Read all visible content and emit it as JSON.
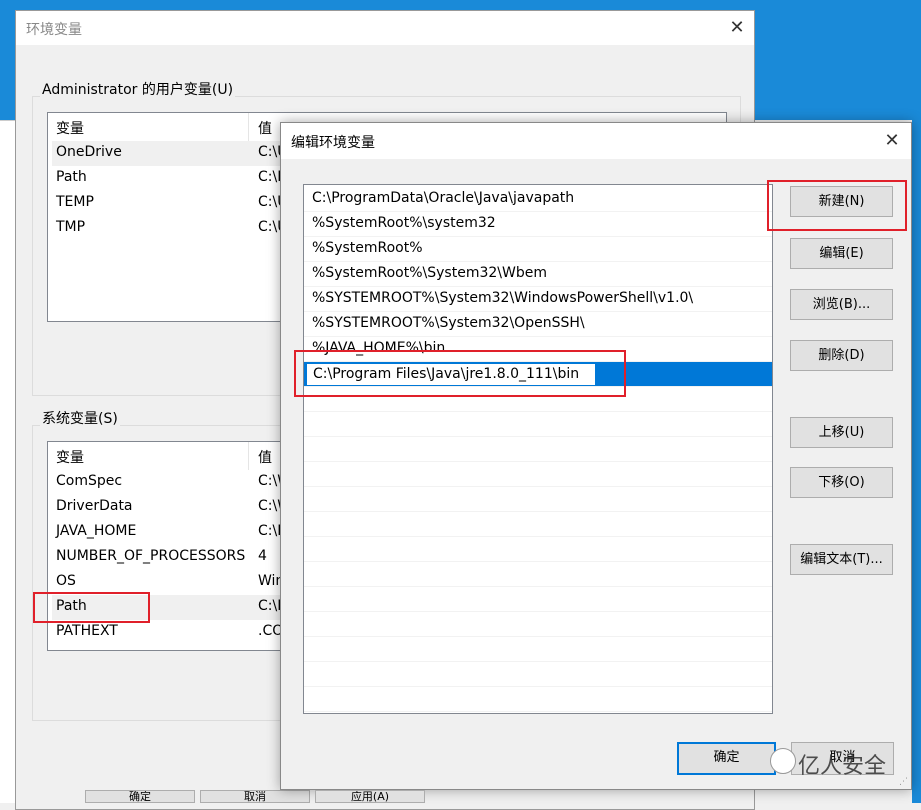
{
  "env_window": {
    "title": "环境变量",
    "close": "✕",
    "user_group": {
      "label": "Administrator 的用户变量(U)",
      "columns": [
        "变量",
        "值"
      ],
      "rows": [
        {
          "name": "OneDrive",
          "value": "C:\\U"
        },
        {
          "name": "Path",
          "value": "C:\\P"
        },
        {
          "name": "TEMP",
          "value": "C:\\U"
        },
        {
          "name": "TMP",
          "value": "C:\\U"
        }
      ]
    },
    "system_group": {
      "label": "系统变量(S)",
      "columns": [
        "变量",
        "值"
      ],
      "rows": [
        {
          "name": "ComSpec",
          "value": "C:\\W"
        },
        {
          "name": "DriverData",
          "value": "C:\\W"
        },
        {
          "name": "JAVA_HOME",
          "value": "C:\\P"
        },
        {
          "name": "NUMBER_OF_PROCESSORS",
          "value": "4"
        },
        {
          "name": "OS",
          "value": "Win"
        },
        {
          "name": "Path",
          "value": "C:\\P"
        },
        {
          "name": "PATHEXT",
          "value": ".CO"
        }
      ]
    },
    "bottom_buttons": [
      "确定",
      "取消",
      "应用(A)"
    ]
  },
  "edit_dialog": {
    "title": "编辑环境变量",
    "close": "✕",
    "paths": [
      "C:\\ProgramData\\Oracle\\Java\\javapath",
      "%SystemRoot%\\system32",
      "%SystemRoot%",
      "%SystemRoot%\\System32\\Wbem",
      "%SYSTEMROOT%\\System32\\WindowsPowerShell\\v1.0\\",
      "%SYSTEMROOT%\\System32\\OpenSSH\\",
      "%JAVA_HOME%\\bin"
    ],
    "editing_value": "C:\\Program Files\\Java\\jre1.8.0_111\\bin",
    "buttons": {
      "new": "新建(N)",
      "edit": "编辑(E)",
      "browse": "浏览(B)...",
      "delete": "删除(D)",
      "up": "上移(U)",
      "down": "下移(O)",
      "edit_text": "编辑文本(T)...",
      "ok": "确定",
      "cancel": "取消"
    }
  },
  "watermark": "亿人安全",
  "colors": {
    "selection": "#0078d7",
    "highlight_box": "#e0202a",
    "desktop": "#1a8ad8"
  }
}
